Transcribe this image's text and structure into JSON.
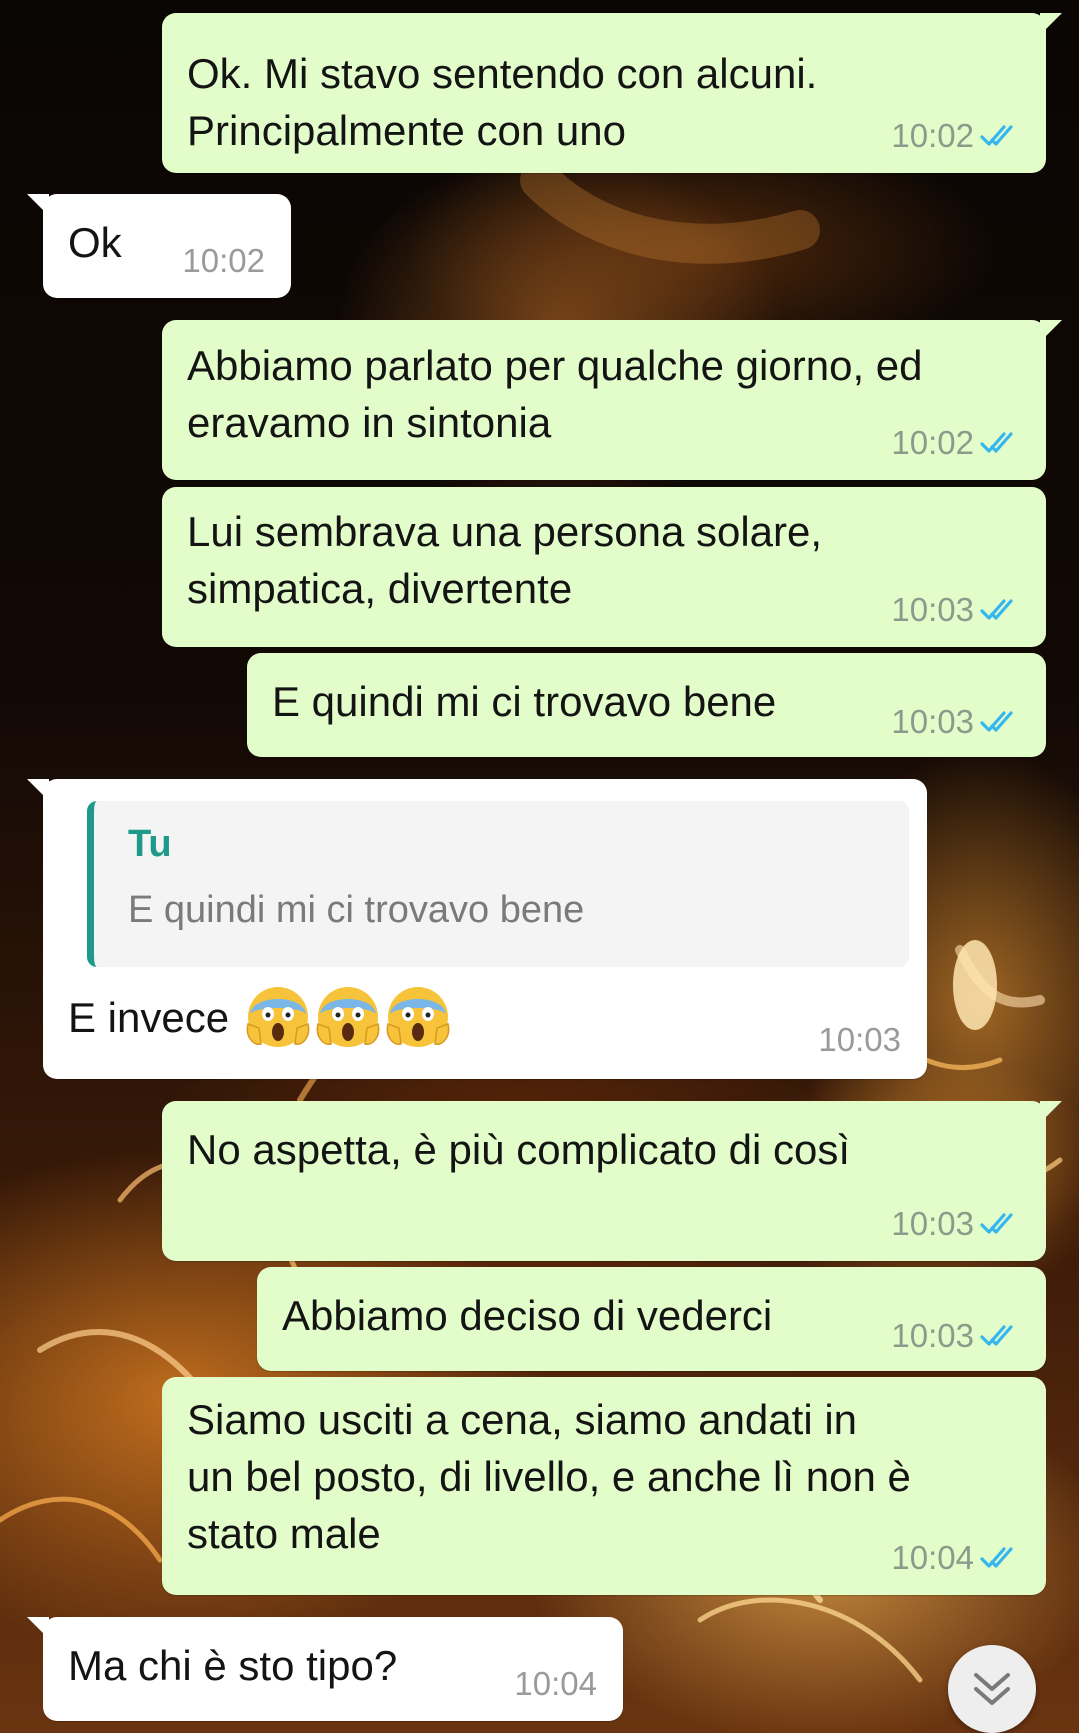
{
  "messages": [
    {
      "direction": "outgoing",
      "lines": [
        "Ok. Mi stavo sentendo con alcuni.",
        "Principalmente con uno"
      ],
      "time": "10:02",
      "status": "read"
    },
    {
      "direction": "incoming",
      "lines": [
        "Ok"
      ],
      "time": "10:02"
    },
    {
      "direction": "outgoing",
      "lines": [
        "Abbiamo parlato per qualche giorno, ed",
        "eravamo in sintonia"
      ],
      "time": "10:02",
      "status": "read"
    },
    {
      "direction": "outgoing",
      "lines": [
        "Lui sembrava una persona solare,",
        "simpatica, divertente"
      ],
      "time": "10:03",
      "status": "read"
    },
    {
      "direction": "outgoing",
      "lines": [
        "E quindi mi ci trovavo bene"
      ],
      "time": "10:03",
      "status": "read"
    },
    {
      "direction": "incoming",
      "reply_to": {
        "author": "Tu",
        "text": "E quindi mi ci trovavo bene"
      },
      "lines": [
        "E invece"
      ],
      "emoji": [
        "face-screaming-in-fear",
        "face-screaming-in-fear",
        "face-screaming-in-fear"
      ],
      "time": "10:03"
    },
    {
      "direction": "outgoing",
      "lines": [
        "No aspetta, è più complicato di così"
      ],
      "time": "10:03",
      "status": "read"
    },
    {
      "direction": "outgoing",
      "lines": [
        "Abbiamo deciso di vederci"
      ],
      "time": "10:03",
      "status": "read"
    },
    {
      "direction": "outgoing",
      "lines": [
        "Siamo usciti a cena, siamo andati in",
        "un bel posto, di livello, e anche lì non è",
        "stato male"
      ],
      "time": "10:04",
      "status": "read"
    },
    {
      "direction": "incoming",
      "lines": [
        "Ma chi è sto tipo?"
      ],
      "time": "10:04"
    }
  ],
  "icons": {
    "read_receipt": "double-check-icon",
    "scroll_down": "chevron-double-down-icon"
  },
  "colors": {
    "outgoing_bubble": "#e2fdc9",
    "incoming_bubble": "#ffffff",
    "read_check": "#34b7f1",
    "quote_accent": "#1e9a8a"
  }
}
